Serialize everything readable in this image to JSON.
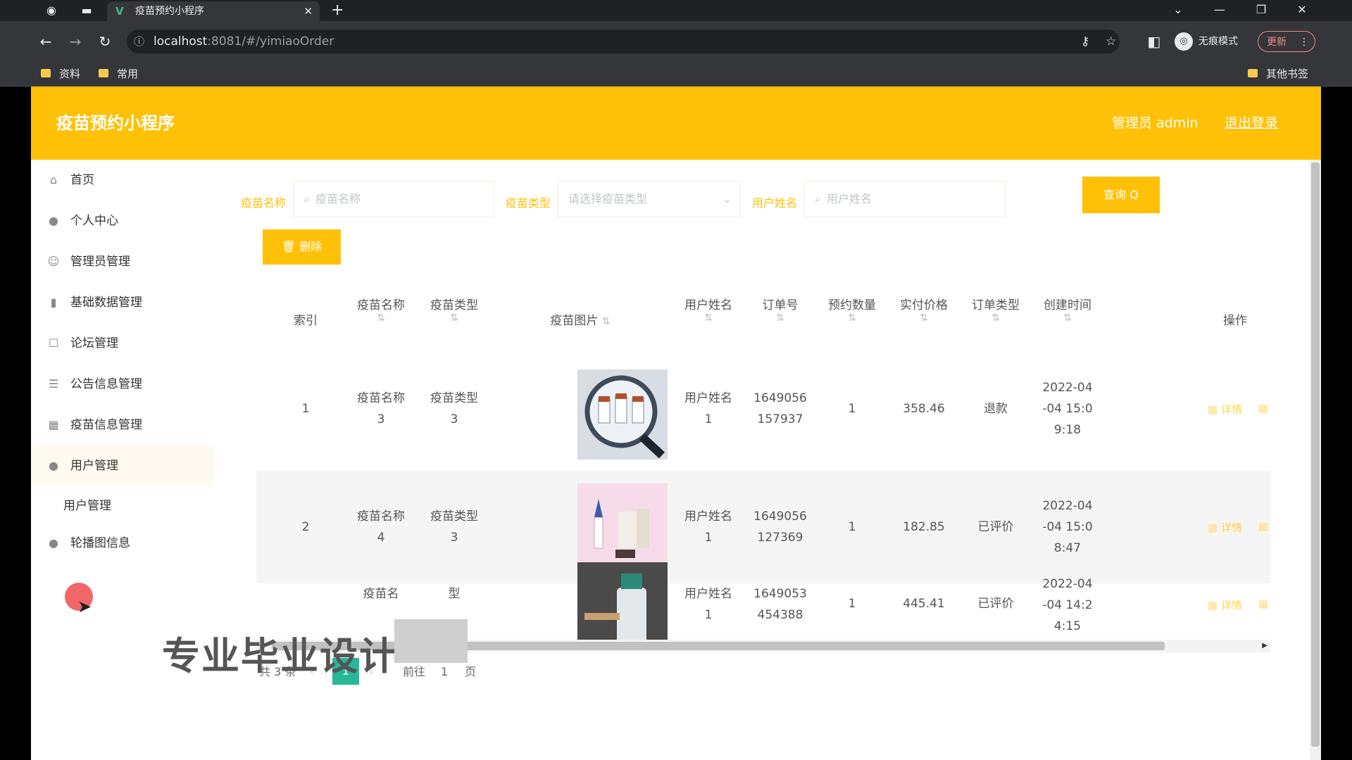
{
  "browser": {
    "tab_title": "疫苗预约小程序",
    "tab_favicon": "V",
    "url_host": "localhost",
    "url_rest": ":8081/#/yimiaoOrder",
    "incognito_label": "无痕模式",
    "update_label": "更新",
    "bookmarks": [
      "资料",
      "常用"
    ],
    "other_bookmarks": "其他书签"
  },
  "header": {
    "brand": "疫苗预约小程序",
    "user": "管理员 admin",
    "logout": "退出登录"
  },
  "sidebar": {
    "items": [
      {
        "label": "首页",
        "icon": "home-icon"
      },
      {
        "label": "个人中心",
        "icon": "person-icon"
      },
      {
        "label": "管理员管理",
        "icon": "admin-icon"
      },
      {
        "label": "基础数据管理",
        "icon": "bar-chart-icon"
      },
      {
        "label": "论坛管理",
        "icon": "forum-icon"
      },
      {
        "label": "公告信息管理",
        "icon": "list-icon"
      },
      {
        "label": "疫苗信息管理",
        "icon": "grid-icon"
      },
      {
        "label": "用户管理",
        "icon": "user-icon"
      },
      {
        "label": "轮播图信息",
        "icon": "image-icon"
      }
    ],
    "sub_items": [
      "用户管理"
    ]
  },
  "search": {
    "fields": [
      {
        "label": "疫苗名称",
        "placeholder": "疫苗名称"
      },
      {
        "label": "疫苗类型",
        "placeholder": "请选择疫苗类型"
      },
      {
        "label": "用户姓名",
        "placeholder": "用户姓名"
      }
    ],
    "query_label": "查询 Q"
  },
  "toolbar": {
    "delete_label": "删除"
  },
  "table": {
    "columns": [
      "索引",
      "疫苗名称",
      "疫苗类型",
      "疫苗图片",
      "用户姓名",
      "订单号",
      "预约数量",
      "实付价格",
      "订单类型",
      "创建时间",
      "操作"
    ],
    "rows": [
      {
        "index": "1",
        "name": [
          "疫苗名称",
          "3"
        ],
        "type": [
          "疫苗类型",
          "3"
        ],
        "user": [
          "用户姓名",
          "1"
        ],
        "order": [
          "1649056",
          "157937"
        ],
        "qty": "1",
        "price": "358.46",
        "status": "退款",
        "time": [
          "2022-04",
          "-04 15:0",
          "9:18"
        ],
        "detail": "详情"
      },
      {
        "index": "2",
        "name": [
          "疫苗名称",
          "4"
        ],
        "type": [
          "疫苗类型",
          "3"
        ],
        "user": [
          "用户姓名",
          "1"
        ],
        "order": [
          "1649056",
          "127369"
        ],
        "qty": "1",
        "price": "182.85",
        "status": "已评价",
        "time": [
          "2022-04",
          "-04 15:0",
          "8:47"
        ],
        "detail": "详情"
      },
      {
        "index": "",
        "name": [
          "疫苗名",
          ""
        ],
        "type": [
          "型",
          ""
        ],
        "user": [
          "用户姓名",
          "1"
        ],
        "order": [
          "1649053",
          "454388"
        ],
        "qty": "1",
        "price": "445.41",
        "status": "已评价",
        "time": [
          "2022-04",
          "-04 14:2",
          "4:15"
        ],
        "detail": "详情"
      }
    ]
  },
  "pagination": {
    "total": "共 3 条",
    "current": "1",
    "goto": "前往",
    "goto_value": "1",
    "page_unit": "页"
  },
  "overlay": {
    "watermark": "专业毕业设计"
  },
  "colors": {
    "accent": "#ffc107",
    "page_active": "#26b897"
  }
}
